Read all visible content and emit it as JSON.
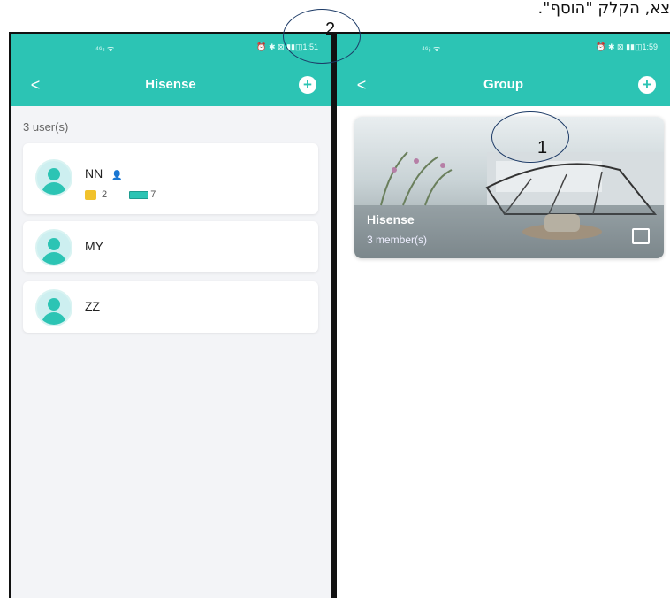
{
  "doc_text": "צא, הקלק \"הוסף\".",
  "left_screen": {
    "status": {
      "signal": "⁴⁶ᵢₗ ᯤ",
      "right": "⏰ ✱ ⊠ ▮▮◫1:51"
    },
    "nav": {
      "back": "<",
      "title": "Hisense",
      "add": "+"
    },
    "user_count": "3 user(s)",
    "users": [
      {
        "name": "NN",
        "badge": "👤",
        "folders": "2",
        "cards": "7"
      },
      {
        "name": "MY"
      },
      {
        "name": "ZZ"
      }
    ]
  },
  "right_screen": {
    "status": {
      "signal": "⁴⁶ᵢₗ ᯤ",
      "right": "⏰ ✱ ⊠ ▮▮◫1:59"
    },
    "nav": {
      "back": "<",
      "title": "Group",
      "add": "+"
    },
    "group": {
      "name": "Hisense",
      "members": "3 member(s)"
    }
  },
  "callouts": {
    "one": "1",
    "two": "2"
  },
  "colors": {
    "accent": "#2cc4b4"
  }
}
